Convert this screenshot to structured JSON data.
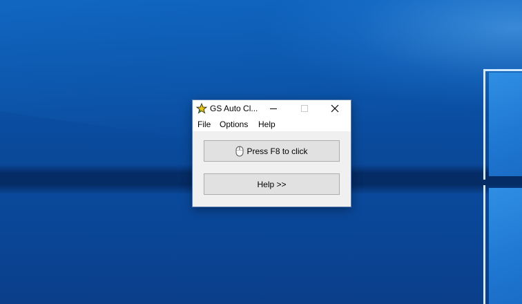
{
  "window": {
    "title": "GS Auto Cl...",
    "app_icon": "star-icon",
    "controls": {
      "minimize": "minimize-icon",
      "maximize": "maximize-icon",
      "close": "close-icon"
    }
  },
  "menu": {
    "items": [
      {
        "label": "File"
      },
      {
        "label": "Options"
      },
      {
        "label": "Help"
      }
    ]
  },
  "buttons": {
    "click": {
      "label": "Press F8 to click",
      "icon": "mouse-icon"
    },
    "help": {
      "label": "Help >>"
    }
  },
  "colors": {
    "desktop_blue": "#0a4fa3",
    "window_bg": "#f0f0f0",
    "button_bg": "#e1e1e1",
    "button_border": "#adadad",
    "star_gold": "#e8c21a"
  }
}
